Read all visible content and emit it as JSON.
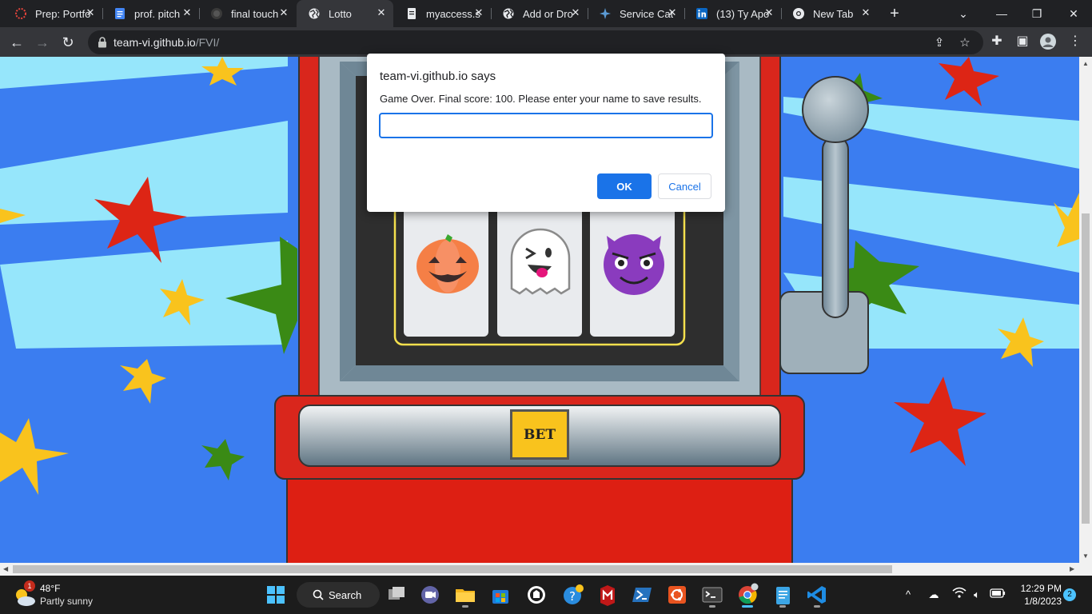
{
  "browser": {
    "tabs": [
      {
        "title": "Prep: Portfo",
        "favicon": "red-dotted-circle-icon"
      },
      {
        "title": "prof. pitch",
        "favicon": "google-docs-icon"
      },
      {
        "title": "final touch",
        "favicon": "github-icon"
      },
      {
        "title": "Lotto",
        "favicon": "globe-icon",
        "active": true
      },
      {
        "title": "myaccess.s",
        "favicon": "document-icon"
      },
      {
        "title": "Add or Dro",
        "favicon": "globe-icon"
      },
      {
        "title": "Service Cat",
        "favicon": "servicenow-star-icon"
      },
      {
        "title": "(13) Ty Apo",
        "favicon": "linkedin-icon"
      },
      {
        "title": "New Tab",
        "favicon": "chrome-icon"
      }
    ],
    "url_host": "team-vi.github.io",
    "url_path": "/FVI/"
  },
  "game": {
    "bet_label": "BET",
    "reels": [
      "jack-o-lantern",
      "ghost",
      "smiling-devil"
    ],
    "colors": {
      "sky": "#3b7df0",
      "stripe": "#96e6fb",
      "machine_red": "#d9261c",
      "bet_yellow": "#f9c31d"
    }
  },
  "dialog": {
    "title": "team-vi.github.io says",
    "message": "Game Over. Final score: 100. Please enter your name to save results.",
    "input_value": "",
    "ok_label": "OK",
    "cancel_label": "Cancel"
  },
  "taskbar": {
    "weather_temp": "48°F",
    "weather_desc": "Partly sunny",
    "weather_badge": "1",
    "search_label": "Search",
    "time": "12:29 PM",
    "date": "1/8/2023",
    "notifications": "2"
  }
}
